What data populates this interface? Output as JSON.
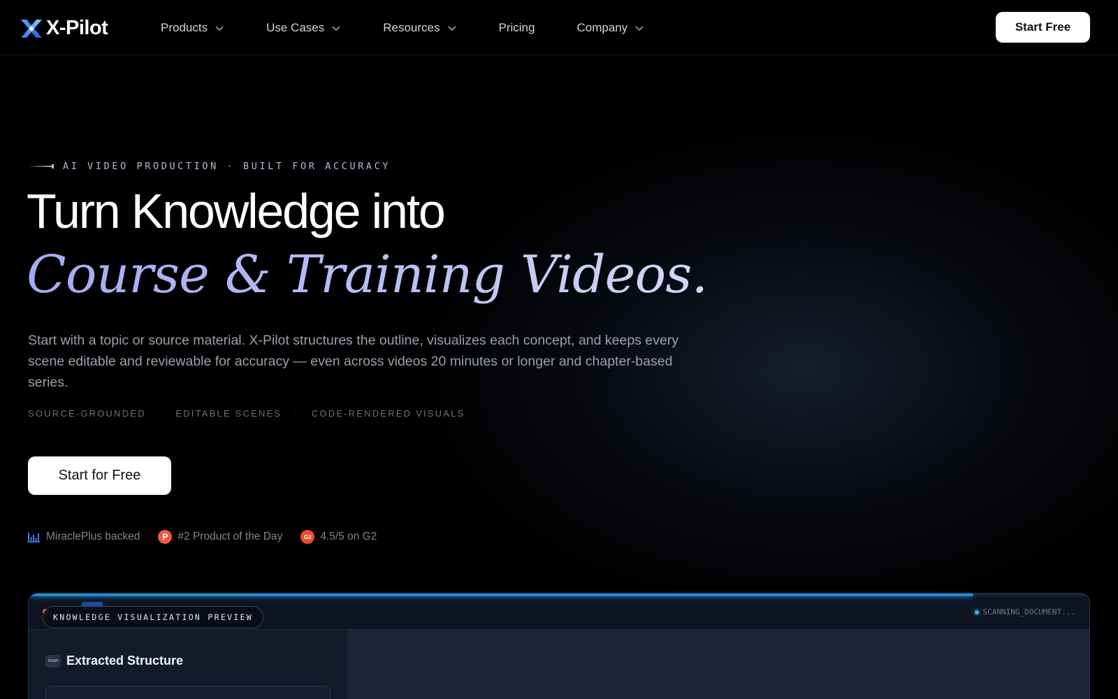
{
  "nav": {
    "logo_text": "X-Pilot",
    "items": [
      {
        "label": "Products",
        "dropdown": true
      },
      {
        "label": "Use Cases",
        "dropdown": true
      },
      {
        "label": "Resources",
        "dropdown": true
      },
      {
        "label": "Pricing",
        "dropdown": false
      },
      {
        "label": "Company",
        "dropdown": true
      }
    ],
    "cta_label": "Start Free"
  },
  "hero": {
    "eyebrow": "AI VIDEO PRODUCTION · BUILT FOR ACCURACY",
    "title_line1": "Turn Knowledge into",
    "title_line2": "Course & Training Videos.",
    "description": "Start with a topic or source material. X-Pilot structures the outline, visualizes each concept, and keeps every scene editable and reviewable for accuracy — even across videos 20 minutes or longer and chapter-based series.",
    "tags": [
      "SOURCE-GROUNDED",
      "EDITABLE SCENES",
      "CODE-RENDERED VISUALS"
    ],
    "tag_separator": "·",
    "cta_label": "Start for Free",
    "proof": {
      "miracleplus": "MiraclePlus backed",
      "producthunt_badge": "P",
      "producthunt": "#2 Product of the Day",
      "g2_badge": "G2",
      "g2": "4.5/5 on G2"
    }
  },
  "preview": {
    "label": "KNOWLEDGE VISUALIZATION PREVIEW",
    "status": "SCANNING_DOCUMENT...",
    "progress": 0.89,
    "panel_icon_label": "icon",
    "section_title": "Extracted Structure"
  },
  "colors": {
    "background": "#000000",
    "accent_gradient": "#a4abf2",
    "progress": "#1a8cd8",
    "producthunt": "#ea5b43",
    "g2": "#ef4b2a"
  },
  "icons": {
    "logo": "x-logo-icon",
    "chevron": "chevron-down-icon",
    "miracleplus": "bar-chart-icon",
    "status_dot": "status-dot-icon"
  }
}
